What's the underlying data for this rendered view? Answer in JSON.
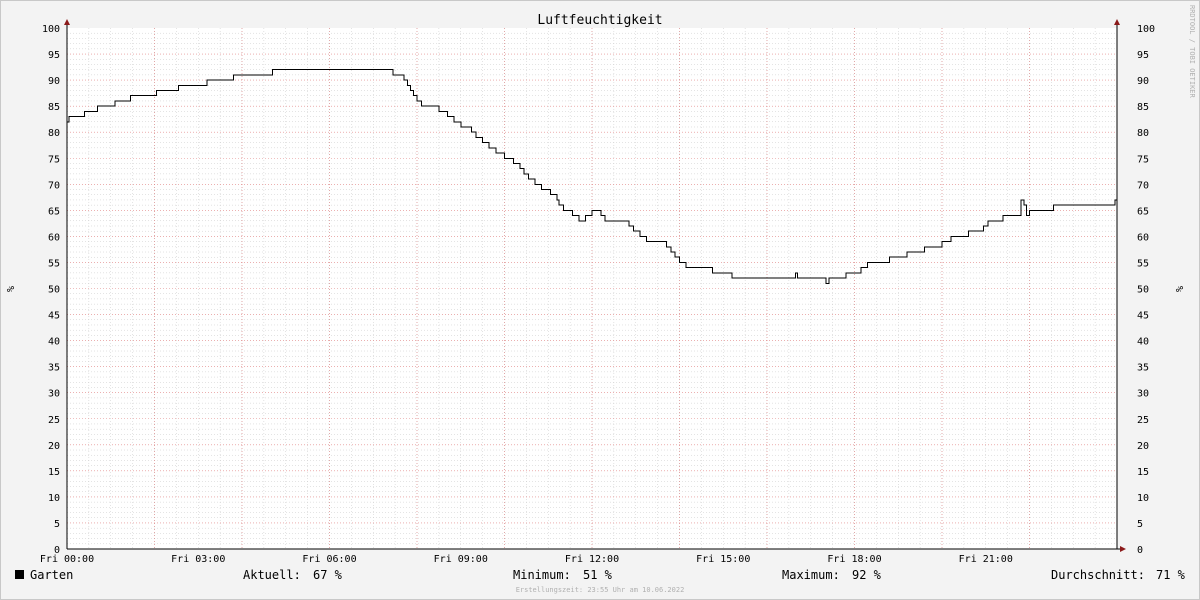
{
  "chart_data": {
    "type": "line",
    "title": "Luftfeuchtigkeit",
    "ylabel": "%",
    "ylabel_right": "%",
    "ylim": [
      0,
      100
    ],
    "y_ticks": [
      0,
      5,
      10,
      15,
      20,
      25,
      30,
      35,
      40,
      45,
      50,
      55,
      60,
      65,
      70,
      75,
      80,
      85,
      90,
      95,
      100
    ],
    "xlim": [
      0,
      24
    ],
    "x_ticks": [
      {
        "value": 0,
        "label": "Fri 00:00"
      },
      {
        "value": 3,
        "label": "Fri 03:00"
      },
      {
        "value": 6,
        "label": "Fri 06:00"
      },
      {
        "value": 9,
        "label": "Fri 09:00"
      },
      {
        "value": 12,
        "label": "Fri 12:00"
      },
      {
        "value": 15,
        "label": "Fri 15:00"
      },
      {
        "value": 18,
        "label": "Fri 18:00"
      },
      {
        "value": 21,
        "label": "Fri 21:00"
      }
    ],
    "grid": true,
    "series": [
      {
        "name": "Garten",
        "color": "#000000",
        "step": true,
        "points": [
          [
            0.0,
            82
          ],
          [
            0.05,
            83
          ],
          [
            0.4,
            84
          ],
          [
            0.7,
            85
          ],
          [
            1.1,
            86
          ],
          [
            1.45,
            87
          ],
          [
            2.05,
            88
          ],
          [
            2.55,
            89
          ],
          [
            3.2,
            90
          ],
          [
            3.8,
            91
          ],
          [
            4.7,
            92
          ],
          [
            7.45,
            91
          ],
          [
            7.7,
            90
          ],
          [
            7.78,
            89
          ],
          [
            7.85,
            88
          ],
          [
            7.92,
            87
          ],
          [
            8.0,
            86
          ],
          [
            8.1,
            85
          ],
          [
            8.5,
            84
          ],
          [
            8.7,
            83
          ],
          [
            8.85,
            82
          ],
          [
            9.0,
            81
          ],
          [
            9.25,
            80
          ],
          [
            9.35,
            79
          ],
          [
            9.5,
            78
          ],
          [
            9.65,
            77
          ],
          [
            9.8,
            76
          ],
          [
            10.0,
            75
          ],
          [
            10.2,
            74
          ],
          [
            10.35,
            73
          ],
          [
            10.45,
            72
          ],
          [
            10.55,
            71
          ],
          [
            10.7,
            70
          ],
          [
            10.85,
            69
          ],
          [
            11.05,
            68
          ],
          [
            11.2,
            67
          ],
          [
            11.25,
            66
          ],
          [
            11.35,
            65
          ],
          [
            11.55,
            64
          ],
          [
            11.7,
            63
          ],
          [
            11.85,
            64
          ],
          [
            12.0,
            65
          ],
          [
            12.2,
            64
          ],
          [
            12.3,
            63
          ],
          [
            12.85,
            62
          ],
          [
            12.95,
            61
          ],
          [
            13.1,
            60
          ],
          [
            13.25,
            59
          ],
          [
            13.7,
            58
          ],
          [
            13.8,
            57
          ],
          [
            13.9,
            56
          ],
          [
            14.0,
            55
          ],
          [
            14.15,
            54
          ],
          [
            14.75,
            53
          ],
          [
            15.2,
            52
          ],
          [
            16.65,
            53
          ],
          [
            16.7,
            52
          ],
          [
            17.35,
            51
          ],
          [
            17.42,
            52
          ],
          [
            17.8,
            53
          ],
          [
            18.15,
            54
          ],
          [
            18.3,
            55
          ],
          [
            18.8,
            56
          ],
          [
            19.2,
            57
          ],
          [
            19.6,
            58
          ],
          [
            20.0,
            59
          ],
          [
            20.2,
            60
          ],
          [
            20.6,
            61
          ],
          [
            20.95,
            62
          ],
          [
            21.05,
            63
          ],
          [
            21.4,
            64
          ],
          [
            21.8,
            67
          ],
          [
            21.87,
            66
          ],
          [
            21.93,
            64
          ],
          [
            22.0,
            65
          ],
          [
            22.55,
            66
          ],
          [
            23.45,
            66
          ],
          [
            23.95,
            67
          ]
        ]
      }
    ],
    "legend": {
      "series_name": "Garten",
      "current_label": "Aktuell:",
      "current_value": "67 %",
      "min_label": "Minimum:",
      "min_value": "51 %",
      "max_label": "Maximum:",
      "max_value": "92 %",
      "avg_label": "Durchschnitt:",
      "avg_value": "71 %"
    },
    "credit": "RRDTOOL / TOBI OETIKER",
    "timestamp": "Erstellungszeit: 23:55 Uhr am 10.06.2022"
  },
  "colors": {
    "background": "#f3f3f3",
    "canvas": "#ffffff",
    "minor_grid": "#c8c8c8",
    "major_grid": "#e08080",
    "axis_arrow": "#8b1a1a",
    "line": "#000000"
  }
}
